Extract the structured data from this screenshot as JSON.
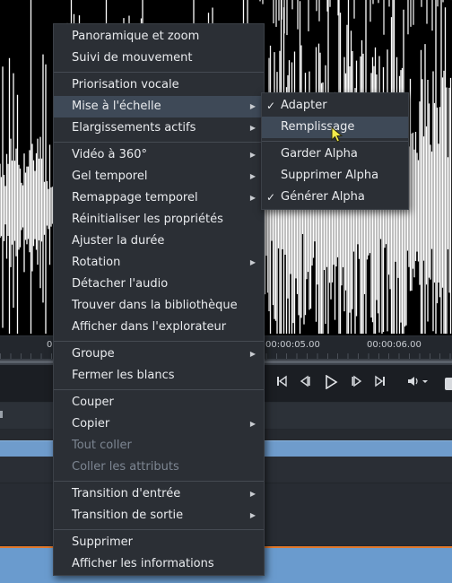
{
  "timeline": {
    "ruler_labels": [
      "0",
      "00:00:05.00",
      "00:00:06.00"
    ]
  },
  "transport": {
    "icons": [
      "go-to-start-icon",
      "previous-frame-icon",
      "play-icon",
      "next-frame-icon",
      "go-to-end-icon",
      "volume-icon"
    ]
  },
  "context_menu": {
    "items": [
      {
        "label": "Panoramique et zoom",
        "name": "menu-item-pan-zoom"
      },
      {
        "label": "Suivi de mouvement",
        "name": "menu-item-motion-tracking"
      },
      {
        "label": "Priorisation vocale",
        "name": "menu-item-voice-priority"
      },
      {
        "label": "Mise à l'échelle",
        "name": "menu-item-scaling"
      },
      {
        "label": "Elargissements actifs",
        "name": "menu-item-active-widening"
      },
      {
        "label": "Vidéo à 360°",
        "name": "menu-item-video-360"
      },
      {
        "label": "Gel temporel",
        "name": "menu-item-time-freeze"
      },
      {
        "label": "Remappage temporel",
        "name": "menu-item-time-remap"
      },
      {
        "label": "Réinitialiser les propriétés",
        "name": "menu-item-reset-properties"
      },
      {
        "label": "Ajuster la durée",
        "name": "menu-item-adjust-duration"
      },
      {
        "label": "Rotation",
        "name": "menu-item-rotation"
      },
      {
        "label": "Détacher l'audio",
        "name": "menu-item-detach-audio"
      },
      {
        "label": "Trouver dans la bibliothèque",
        "name": "menu-item-find-in-library"
      },
      {
        "label": "Afficher dans l'explorateur",
        "name": "menu-item-show-in-explorer"
      },
      {
        "label": "Groupe",
        "name": "menu-item-group"
      },
      {
        "label": "Fermer les blancs",
        "name": "menu-item-close-gaps"
      },
      {
        "label": "Couper",
        "name": "menu-item-cut"
      },
      {
        "label": "Copier",
        "name": "menu-item-copy"
      },
      {
        "label": "Tout coller",
        "name": "menu-item-paste-all"
      },
      {
        "label": "Coller les attributs",
        "name": "menu-item-paste-attributes"
      },
      {
        "label": "Transition d'entrée",
        "name": "menu-item-transition-in"
      },
      {
        "label": "Transition de sortie",
        "name": "menu-item-transition-out"
      },
      {
        "label": "Supprimer",
        "name": "menu-item-delete"
      },
      {
        "label": "Afficher les informations",
        "name": "menu-item-show-info"
      }
    ]
  },
  "scaling_submenu": {
    "items": [
      {
        "label": "Adapter",
        "checked": true
      },
      {
        "label": "Remplissage",
        "checked": false,
        "highlighted": true
      },
      {
        "label": "Garder Alpha",
        "checked": false
      },
      {
        "label": "Supprimer Alpha",
        "checked": false
      },
      {
        "label": "Générer Alpha",
        "checked": true
      }
    ],
    "check_glyph": "✓"
  },
  "colors": {
    "menu_bg": "#2b2f35",
    "menu_highlight": "#3e4957",
    "disabled_text": "#7d8692",
    "clip_blue": "#6f9ccc",
    "accent_orange": "#e0782c",
    "cursor_yellow": "#f4ec4a"
  }
}
